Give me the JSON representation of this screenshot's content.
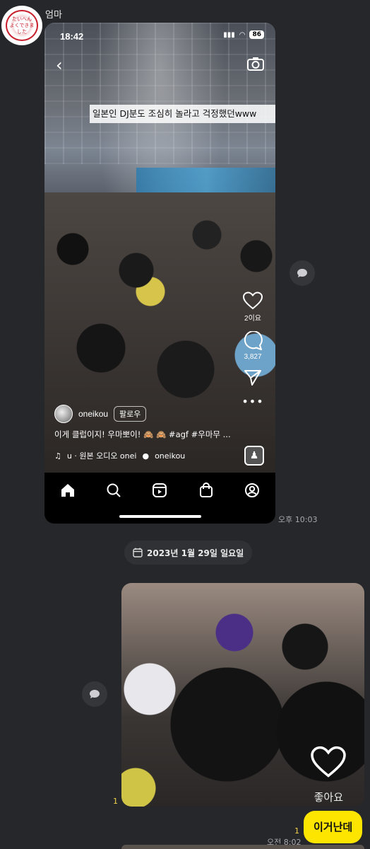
{
  "chat": {
    "sender_name": "엄마",
    "message1_time": "오후 10:03",
    "date_divider": "2023년 1월 29일 일요일",
    "message2_read": "1",
    "message3_read": "1",
    "message3_time": "오전 8:02",
    "message3_text": "이거난데"
  },
  "phone_screenshot": {
    "status_time": "18:42",
    "battery": "86",
    "caption_overlay": "일본인 DJ분도 조심히 놀라고 걱정했던www",
    "like_count": "2이요",
    "comment_count": "3,827",
    "author": "oneikou",
    "follow_label": "팔로우",
    "post_caption": "이게 클럽이지! 우마뽀이! 🙈 🙈 #agf #우마무 ...",
    "audio_text": "u · 원본 오디오  onei",
    "audio_author": "oneikou",
    "nav_icons": [
      "home-icon",
      "search-icon",
      "reels-icon",
      "shop-icon",
      "profile-icon"
    ]
  },
  "second_screenshot": {
    "like_label": "좋아요"
  },
  "colors": {
    "background": "#26272b",
    "my_bubble": "#fee500",
    "read_count": "#f2d24a"
  }
}
